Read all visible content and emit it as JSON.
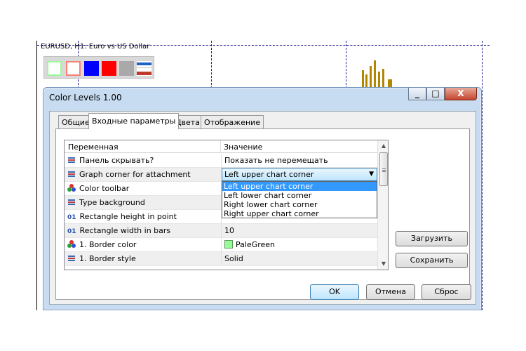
{
  "chart": {
    "title": "EURUSD, H1:  Euro vs US Dollar",
    "toolbar_swatches": [
      {
        "name": "palegreen",
        "color": "#98fb98"
      },
      {
        "name": "salmon",
        "color": "#fa8072"
      },
      {
        "name": "blue",
        "color": "#0000ff"
      },
      {
        "name": "red",
        "color": "#ff0000"
      },
      {
        "name": "gray",
        "color": "#a9a9a9"
      },
      {
        "name": "style",
        "color": "#1e64c8"
      }
    ]
  },
  "dialog": {
    "title": "Color Levels 1.00",
    "window_buttons": {
      "minimize": "_",
      "maximize": "□",
      "close": "X"
    },
    "tabs": [
      {
        "label": "Общие",
        "active": false
      },
      {
        "label": "Входные параметры",
        "active": true
      },
      {
        "label": "Цвета",
        "active": false
      },
      {
        "label": "Отображение",
        "active": false
      }
    ],
    "grid": {
      "headers": {
        "variable": "Переменная",
        "value": "Значение"
      },
      "rows": [
        {
          "icon": "enum-icon",
          "name": "Панель скрывать?",
          "value": "Показать не перемещать"
        },
        {
          "icon": "enum-icon",
          "name": "Graph corner for attachment",
          "value": "Left upper chart corner"
        },
        {
          "icon": "color-icon",
          "name": "Color toolbar",
          "value": ""
        },
        {
          "icon": "enum-icon",
          "name": "Type background",
          "value": ""
        },
        {
          "icon": "number-icon",
          "icon_text": "01",
          "name": "Rectangle height in point",
          "value": ""
        },
        {
          "icon": "number-icon",
          "icon_text": "01",
          "name": "Rectangle width in bars",
          "value": "10"
        },
        {
          "icon": "color-icon",
          "name": "1. Border color",
          "value": "PaleGreen",
          "swatch": "#98fb98"
        },
        {
          "icon": "enum-icon",
          "name": "1. Border style",
          "value": "Solid"
        }
      ]
    },
    "combo": {
      "value": "Left upper chart corner",
      "options": [
        "Left upper chart corner",
        "Left lower chart corner",
        "Right lower chart corner",
        "Right upper chart corner"
      ],
      "selected_index": 0
    },
    "side_buttons": {
      "load": "Загрузить",
      "save": "Сохранить"
    },
    "footer_buttons": {
      "ok": "OK",
      "cancel": "Отмена",
      "reset": "Сброс"
    }
  }
}
